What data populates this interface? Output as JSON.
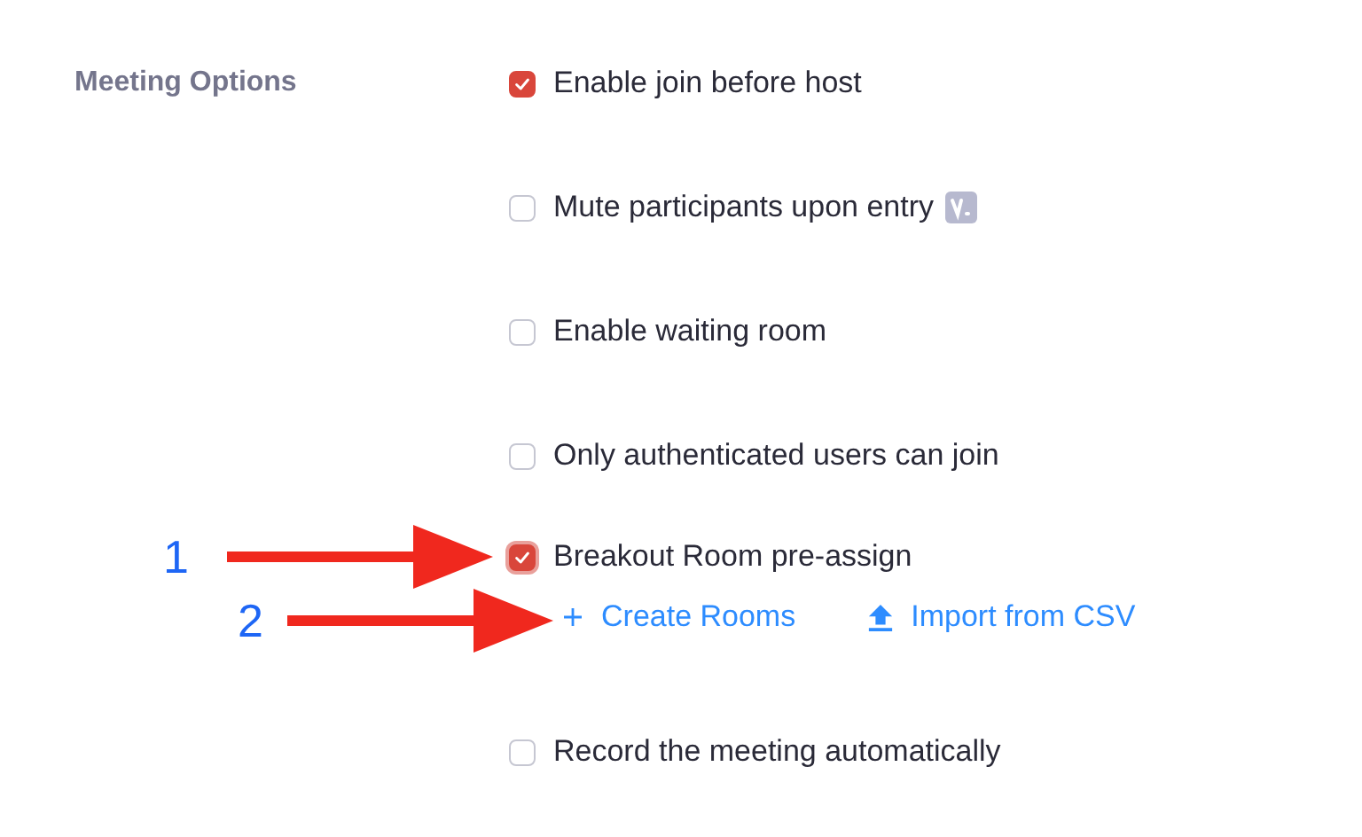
{
  "section_label": "Meeting Options",
  "options": [
    {
      "label": "Enable join before host",
      "checked": true,
      "focused": false,
      "badge": false
    },
    {
      "label": "Mute participants upon entry",
      "checked": false,
      "focused": false,
      "badge": true
    },
    {
      "label": "Enable waiting room",
      "checked": false,
      "focused": false,
      "badge": false
    },
    {
      "label": "Only authenticated users can join",
      "checked": false,
      "focused": false,
      "badge": false
    },
    {
      "label": "Breakout Room pre-assign",
      "checked": true,
      "focused": true,
      "badge": false,
      "links": [
        {
          "kind": "plus",
          "label": "Create Rooms"
        },
        {
          "kind": "upload",
          "label": "Import from CSV"
        }
      ]
    },
    {
      "label": "Record the meeting automatically",
      "checked": false,
      "focused": false,
      "badge": false
    }
  ],
  "annotations": [
    {
      "label": "1"
    },
    {
      "label": "2"
    }
  ]
}
